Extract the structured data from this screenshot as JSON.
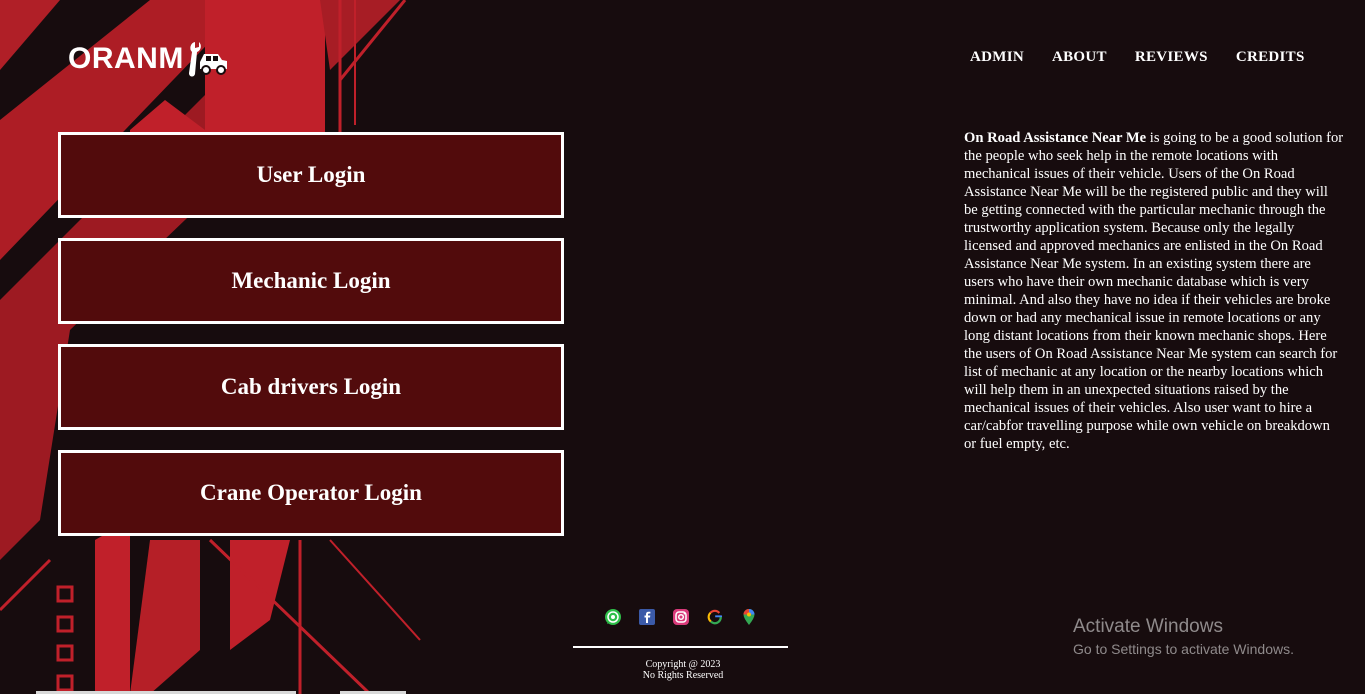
{
  "brand": {
    "name": "ORANM",
    "icon": "wrench-car-icon"
  },
  "nav": [
    {
      "label": "ADMIN"
    },
    {
      "label": "ABOUT"
    },
    {
      "label": "REVIEWS"
    },
    {
      "label": "CREDITS"
    }
  ],
  "logins": [
    {
      "label": "User Login"
    },
    {
      "label": "Mechanic Login"
    },
    {
      "label": "Cab drivers Login"
    },
    {
      "label": "Crane Operator Login"
    }
  ],
  "about": {
    "highlight": "On Road Assistance Near Me",
    "text": " is going to be a good solution for the people who seek help in the remote locations with mechanical issues of their vehicle. Users of the On Road Assistance Near Me will be the registered public and they will be getting connected with the particular mechanic through the trustworthy application system. Because only the legally licensed and approved mechanics are enlisted in the On Road Assistance Near Me system. In an existing system there are users who have their own mechanic database which is very minimal. And also they have no idea if their vehicles are broke down or had any mechanical issue in remote locations or any long distant locations from their known mechanic shops. Here the users of On Road Assistance Near Me system can search for list of mechanic at any location or the nearby locations which will help them in an unexpected situations raised by the mechanical issues of their vehicles. Also user want to hire a car/cabfor travelling purpose while own vehicle on breakdown or fuel empty, etc."
  },
  "social": [
    "whatsapp-icon",
    "facebook-icon",
    "instagram-icon",
    "google-icon",
    "maps-pin-icon"
  ],
  "footer": {
    "copyright": "Copyright @ 2023",
    "rights": "No Rights Reserved"
  },
  "windows_watermark": {
    "title": "Activate Windows",
    "subtitle": "Go to Settings to activate Windows."
  },
  "colors": {
    "background": "#170c0e",
    "button_fill": "#520b0c",
    "accent_red": "#c0202a"
  }
}
